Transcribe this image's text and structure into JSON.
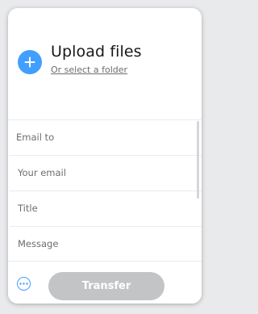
{
  "upload": {
    "title": "Upload files",
    "select_folder": "Or select a folder"
  },
  "fields": [
    {
      "placeholder": "Email to"
    },
    {
      "placeholder": "Your email"
    },
    {
      "placeholder": "Title"
    },
    {
      "placeholder": "Message"
    }
  ],
  "footer": {
    "transfer_label": "Transfer",
    "more_icon": "more-options-icon"
  },
  "colors": {
    "accent": "#409fff",
    "disabled_button": "#c2c4c6"
  }
}
